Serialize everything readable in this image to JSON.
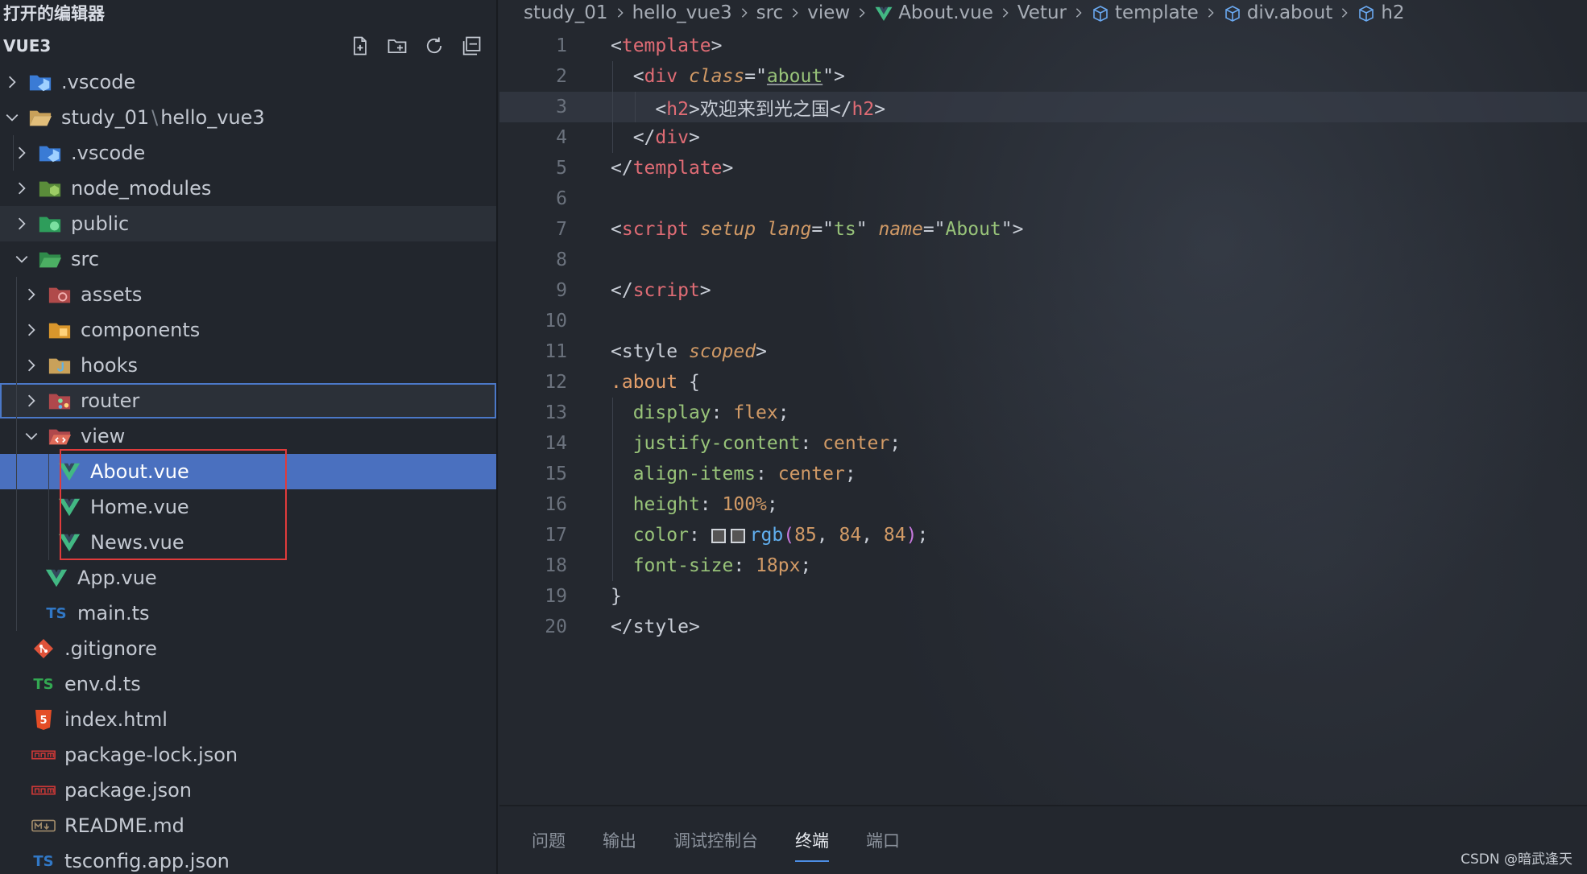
{
  "sidebar": {
    "open_editors_title": "打开的编辑器",
    "project_title": "VUE3",
    "actions": [
      {
        "name": "new-file-icon"
      },
      {
        "name": "new-folder-icon"
      },
      {
        "name": "refresh-icon"
      },
      {
        "name": "collapse-all-icon"
      }
    ],
    "tree": [
      {
        "label": ".vscode",
        "icon": "vscode-folder-icon",
        "expanded": false
      },
      {
        "label": "study_01",
        "sep": "\\",
        "label2": "hello_vue3",
        "icon": "folder-open-icon",
        "expanded": true
      },
      {
        "label": ".vscode",
        "icon": "vscode-folder-icon",
        "expanded": false
      },
      {
        "label": "node_modules",
        "icon": "node-folder-icon",
        "expanded": false
      },
      {
        "label": "public",
        "icon": "public-folder-icon",
        "expanded": false
      },
      {
        "label": "src",
        "icon": "src-folder-icon",
        "expanded": true
      },
      {
        "label": "assets",
        "icon": "assets-folder-icon",
        "expanded": false
      },
      {
        "label": "components",
        "icon": "components-folder-icon",
        "expanded": false
      },
      {
        "label": "hooks",
        "icon": "hooks-folder-icon",
        "expanded": false
      },
      {
        "label": "router",
        "icon": "router-folder-icon",
        "expanded": false
      },
      {
        "label": "view",
        "icon": "view-folder-icon",
        "expanded": true
      },
      {
        "label": "About.vue",
        "icon": "vue-file-icon"
      },
      {
        "label": "Home.vue",
        "icon": "vue-file-icon"
      },
      {
        "label": "News.vue",
        "icon": "vue-file-icon"
      },
      {
        "label": "App.vue",
        "icon": "vue-file-icon"
      },
      {
        "label": "main.ts",
        "icon": "ts-file-icon",
        "glyph": "TS"
      },
      {
        "label": ".gitignore",
        "icon": "git-file-icon"
      },
      {
        "label": "env.d.ts",
        "icon": "ts-file-icon",
        "glyph": "TS"
      },
      {
        "label": "index.html",
        "icon": "html-file-icon",
        "glyph": "5"
      },
      {
        "label": "package-lock.json",
        "icon": "npm-file-icon"
      },
      {
        "label": "package.json",
        "icon": "npm-file-icon"
      },
      {
        "label": "README.md",
        "icon": "markdown-file-icon"
      },
      {
        "label": "tsconfig.app.json",
        "icon": "ts-config-file-icon",
        "glyph": "TS"
      }
    ]
  },
  "breadcrumbs": [
    "study_01",
    "hello_vue3",
    "src",
    "view",
    "About.vue",
    "Vetur",
    "template",
    "div.about",
    "h2"
  ],
  "editor": {
    "current_line": 3,
    "lines": [
      "1",
      "2",
      "3",
      "4",
      "5",
      "6",
      "7",
      "8",
      "9",
      "10",
      "11",
      "12",
      "13",
      "14",
      "15",
      "16",
      "17",
      "18",
      "19",
      "20"
    ],
    "code": {
      "l1_tag": "template",
      "l2_tag": "div",
      "l2_attr": "class",
      "l2_val": "about",
      "l3_tag": "h2",
      "l3_text": "欢迎来到光之国",
      "l4_tag": "div",
      "l5_tag": "template",
      "l7_tag": "script",
      "l7_attr1": "setup",
      "l7_attr2": "lang",
      "l7_val2": "ts",
      "l7_attr3": "name",
      "l7_val3": "About",
      "l9_tag": "script",
      "l11_tag": "style",
      "l11_attr": "scoped",
      "l12_sel": ".about",
      "l13_prop": "display",
      "l13_val": "flex",
      "l14_prop": "justify-content",
      "l14_val": "center",
      "l15_prop": "align-items",
      "l15_val": "center",
      "l16_prop": "height",
      "l16_val": "100%",
      "l17_prop": "color",
      "l17_fn": "rgb",
      "l17_n1": "85",
      "l17_n2": "84",
      "l17_n3": "84",
      "l18_prop": "font-size",
      "l18_val": "18px",
      "l20_tag": "style"
    },
    "swatch_color": "#555454"
  },
  "panel": {
    "tabs": [
      "问题",
      "输出",
      "调试控制台",
      "终端",
      "端口"
    ],
    "active_tab": "终端"
  },
  "watermark": "CSDN @暗武逢天",
  "colors": {
    "selection": "#4a70bf",
    "focus_outline": "#4b78c8",
    "annotation_box": "#e03b3b",
    "vue_green": "#42b883"
  }
}
